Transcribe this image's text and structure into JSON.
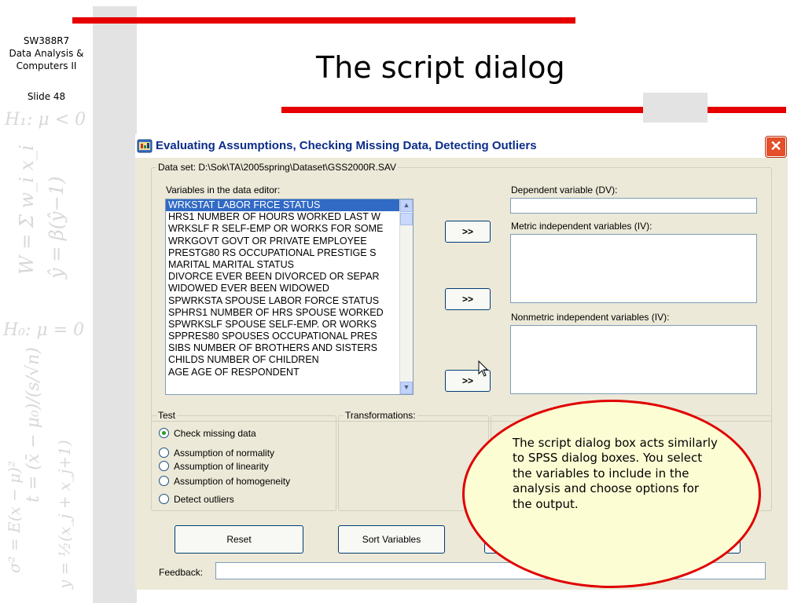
{
  "slide": {
    "course_lines": [
      "SW388R7",
      "Data Analysis &",
      "Computers II"
    ],
    "slide_number": "Slide 48",
    "title": "The script dialog",
    "accent_color": "#e60000"
  },
  "dialog": {
    "title": "Evaluating Assumptions, Checking Missing Data, Detecting Outliers",
    "close_icon": "close-icon",
    "dataset_label": "Data set: D:\\Sok\\TA\\2005spring\\Dataset\\GSS2000R.SAV",
    "variables_label": "Variables in the data editor:",
    "variables": [
      "WRKSTAT   LABOR FRCE STATUS",
      "HRS1   NUMBER OF HOURS WORKED LAST W",
      "WRKSLF   R SELF-EMP OR WORKS FOR SOME",
      "WRKGOVT   GOVT OR PRIVATE EMPLOYEE",
      "PRESTG80   RS OCCUPATIONAL PRESTIGE S",
      "MARITAL   MARITAL STATUS",
      "DIVORCE   EVER BEEN DIVORCED OR SEPAR",
      "WIDOWED   EVER BEEN WIDOWED",
      "SPWRKSTA   SPOUSE LABOR FORCE STATUS",
      "SPHRS1   NUMBER OF HRS SPOUSE WORKED",
      "SPWRKSLF   SPOUSE SELF-EMP. OR WORKS",
      "SPPRES80   SPOUSES OCCUPATIONAL PRES",
      "SIBS   NUMBER OF BROTHERS AND SISTERS",
      "CHILDS   NUMBER OF CHILDREN",
      "AGE   AGE OF RESPONDENT"
    ],
    "selected_variable": "WRKSTAT   LABOR FRCE STATUS",
    "move_button_label": ">>",
    "dv_label": "Dependent variable (DV):",
    "metric_iv_label": "Metric independent variables (IV):",
    "nonmetric_iv_label": "Nonmetric independent variables (IV):",
    "test_group_label": "Test",
    "tests": [
      {
        "label": "Check missing data",
        "selected": true
      },
      {
        "label": "Assumption of normality",
        "selected": false
      },
      {
        "label": "Assumption of linearity",
        "selected": false
      },
      {
        "label": "Assumption of homogeneity",
        "selected": false
      },
      {
        "label": "Detect outliers",
        "selected": false
      }
    ],
    "transformations_label": "Transformations:",
    "reset_label": "Reset",
    "sort_label": "Sort Variables",
    "feedback_label": "Feedback:",
    "feedback_value": ""
  },
  "callout": {
    "text": "The script dialog box acts similarly to SPSS dialog boxes.  You select the variables to include in the analysis and choose options for the output.",
    "border_color": "#e00000",
    "fill_color": "#fdfdd4"
  }
}
